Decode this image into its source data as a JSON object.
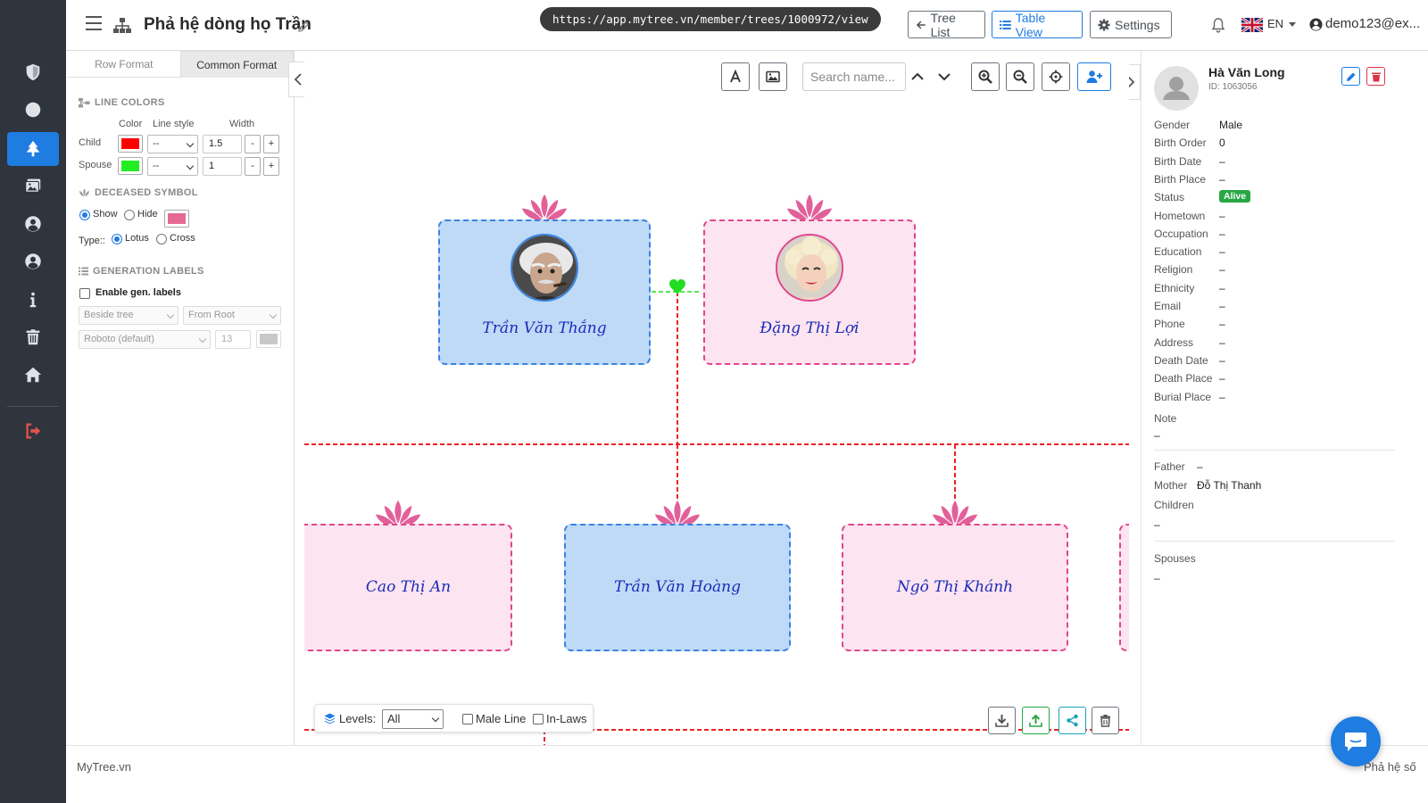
{
  "header": {
    "title": "Phả hệ dòng họ Trần",
    "url": "https://app.mytree.vn/member/trees/1000972/view",
    "tree_list_label": "Tree List",
    "table_view_label": "Table View",
    "settings_label": "Settings",
    "lang": "EN",
    "user_email": "demo123@ex..."
  },
  "sidebar": {
    "items": [
      {
        "icon": "shield-icon",
        "active": false
      },
      {
        "icon": "circle-icon",
        "active": false
      },
      {
        "icon": "tree-icon",
        "active": true
      },
      {
        "icon": "photos-icon",
        "active": false
      },
      {
        "icon": "user-circle-icon",
        "active": false
      },
      {
        "icon": "user-circle-icon",
        "active": false
      },
      {
        "icon": "info-icon",
        "active": false
      },
      {
        "icon": "trash-icon",
        "active": false
      },
      {
        "icon": "home-icon",
        "active": false
      },
      {
        "icon": "logout-icon",
        "active": false
      }
    ]
  },
  "format_panel": {
    "tabs": [
      "Row Format",
      "Common Format"
    ],
    "active_tab": "Common Format",
    "line_colors_title": "LINE COLORS",
    "col_color": "Color",
    "col_line_style": "Line style",
    "col_width": "Width",
    "child_label": "Child",
    "child_color": "#ff0000",
    "child_style": "--",
    "child_width": "1.5",
    "spouse_label": "Spouse",
    "spouse_color": "#22ee22",
    "spouse_style": "--",
    "spouse_width": "1",
    "minus": "-",
    "plus": "+",
    "deceased_title": "DECEASED SYMBOL",
    "show_label": "Show",
    "hide_label": "Hide",
    "symbol_color": "#e66a96",
    "type_label": "Type::",
    "lotus_label": "Lotus",
    "cross_label": "Cross",
    "gen_labels_title": "GENERATION LABELS",
    "enable_gen_label": "Enable gen. labels",
    "position_select": "Beside tree",
    "from_select": "From Root",
    "font_select": "Roboto (default)",
    "font_size": "13"
  },
  "canvas": {
    "search_placeholder": "Search name...",
    "levels_label": "Levels:",
    "levels_value": "All",
    "male_line_label": "Male Line",
    "in_laws_label": "In-Laws",
    "line_colors": {
      "child": "#ee2222",
      "spouse": "#22dd22",
      "male": "#3b82e0",
      "female": "#e0468a"
    },
    "persons": [
      {
        "name": "Trần Văn Thắng",
        "gender": "male",
        "photo": true
      },
      {
        "name": "Đặng Thị Lợi",
        "gender": "female",
        "photo": true
      },
      {
        "name": "Cao Thị An",
        "gender": "female",
        "photo": false
      },
      {
        "name": "Trần Văn Hoàng",
        "gender": "male",
        "photo": false
      },
      {
        "name": "Ngô Thị Khánh",
        "gender": "female",
        "photo": false
      }
    ]
  },
  "detail": {
    "name": "Hà Văn Long",
    "id_text": "ID: 1063056",
    "rows": [
      {
        "label": "Gender",
        "value": "Male"
      },
      {
        "label": "Birth Order",
        "value": "0"
      },
      {
        "label": "Birth Date",
        "value": "–"
      },
      {
        "label": "Birth Place",
        "value": "–"
      },
      {
        "label": "Status",
        "value": "Alive"
      },
      {
        "label": "Hometown",
        "value": "–"
      },
      {
        "label": "Occupation",
        "value": "–"
      },
      {
        "label": "Education",
        "value": "–"
      },
      {
        "label": "Religion",
        "value": "–"
      },
      {
        "label": "Ethnicity",
        "value": "–"
      },
      {
        "label": "Email",
        "value": "–"
      },
      {
        "label": "Phone",
        "value": "–"
      },
      {
        "label": "Address",
        "value": "–"
      },
      {
        "label": "Death Date",
        "value": "–"
      },
      {
        "label": "Death Place",
        "value": "–"
      },
      {
        "label": "Burial Place",
        "value": "–"
      }
    ],
    "note_label": "Note",
    "note_value": "–",
    "father_label": "Father",
    "father_value": "–",
    "mother_label": "Mother",
    "mother_value": "Đỗ Thị Thanh",
    "children_label": "Children",
    "children_value": "–",
    "spouses_label": "Spouses",
    "spouses_value": "–"
  },
  "footer": {
    "left": "MyTree.vn",
    "right": "Phả hệ số"
  }
}
